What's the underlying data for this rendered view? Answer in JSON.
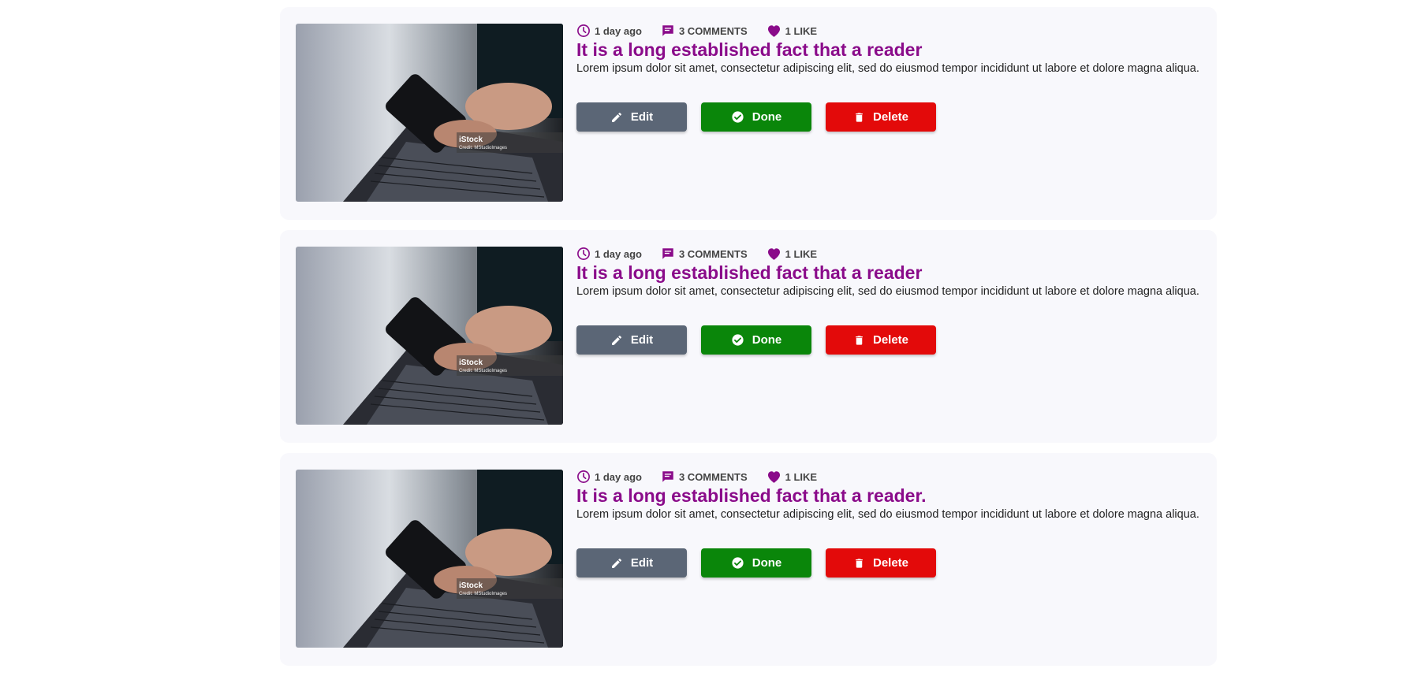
{
  "colors": {
    "card_bg": "#f8f8fc",
    "title": "#8a0b8a",
    "edit": "#5b6676",
    "done": "#0a860a",
    "delete": "#e30a0a",
    "icon": "#8a0b8a"
  },
  "posts": [
    {
      "time": "1 day ago",
      "comments": "3 COMMENTS",
      "likes": "1 LIKE",
      "title": "It is a long established fact that a reader",
      "description": "Lorem ipsum dolor sit amet, consectetur adipiscing elit, sed do eiusmod tempor incididunt ut labore et dolore magna aliqua.",
      "image_brand": "iStock",
      "image_credit": "Credit: MStudioImages",
      "edit_label": "Edit",
      "done_label": "Done",
      "delete_label": "Delete"
    },
    {
      "time": "1 day ago",
      "comments": "3 COMMENTS",
      "likes": "1 LIKE",
      "title": "It is a long established fact that a reader",
      "description": "Lorem ipsum dolor sit amet, consectetur adipiscing elit, sed do eiusmod tempor incididunt ut labore et dolore magna aliqua.",
      "image_brand": "iStock",
      "image_credit": "Credit: MStudioImages",
      "edit_label": "Edit",
      "done_label": "Done",
      "delete_label": "Delete"
    },
    {
      "time": "1 day ago",
      "comments": "3 COMMENTS",
      "likes": "1 LIKE",
      "title": "It is a long established fact that a reader.",
      "description": "Lorem ipsum dolor sit amet, consectetur adipiscing elit, sed do eiusmod tempor incididunt ut labore et dolore magna aliqua.",
      "image_brand": "iStock",
      "image_credit": "Credit: MStudioImages",
      "edit_label": "Edit",
      "done_label": "Done",
      "delete_label": "Delete"
    }
  ],
  "icons": {
    "time": "clock-icon",
    "comments": "comment-icon",
    "likes": "heart-icon",
    "edit": "pencil-icon",
    "done": "check-circle-icon",
    "delete": "trash-icon"
  }
}
